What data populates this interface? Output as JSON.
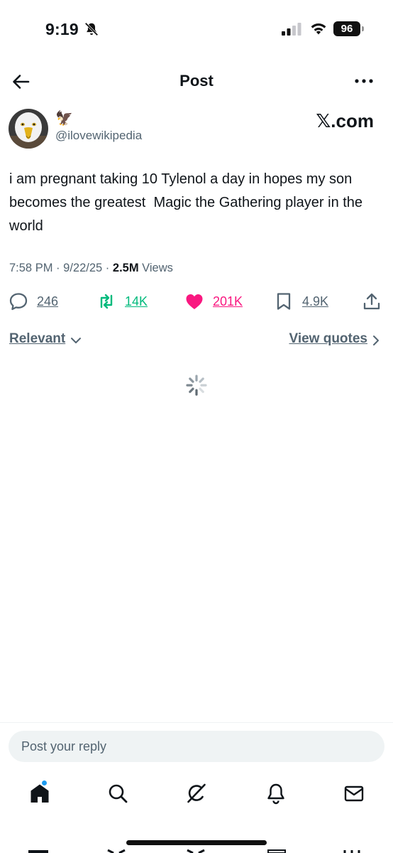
{
  "status_bar": {
    "time": "9:19",
    "battery": "96"
  },
  "header": {
    "title": "Post"
  },
  "author": {
    "emoji": "🦅",
    "handle": "@ilovewikipedia",
    "source": "𝕏.com"
  },
  "tweet": {
    "text": "i am pregnant taking 10 Tylenol a day in hopes my son becomes the greatest  Magic the Gathering player in the world",
    "time": "7:58 PM",
    "sep": "·",
    "date": "9/22/25",
    "views_count": "2.5M",
    "views_label": "Views"
  },
  "actions": {
    "replies": "246",
    "reposts": "14K",
    "likes": "201K",
    "bookmarks": "4.9K"
  },
  "colors": {
    "repost": "#00ba7c",
    "like": "#f91880",
    "muted": "#536471",
    "accent": "#1d9bf0"
  },
  "filters": {
    "sort_label": "Relevant",
    "quotes_label": "View quotes"
  },
  "reply": {
    "placeholder": "Post your reply"
  },
  "tabbar": {
    "icons": [
      "home-icon",
      "search-icon",
      "grok-icon",
      "notifications-icon",
      "messages-icon"
    ]
  }
}
